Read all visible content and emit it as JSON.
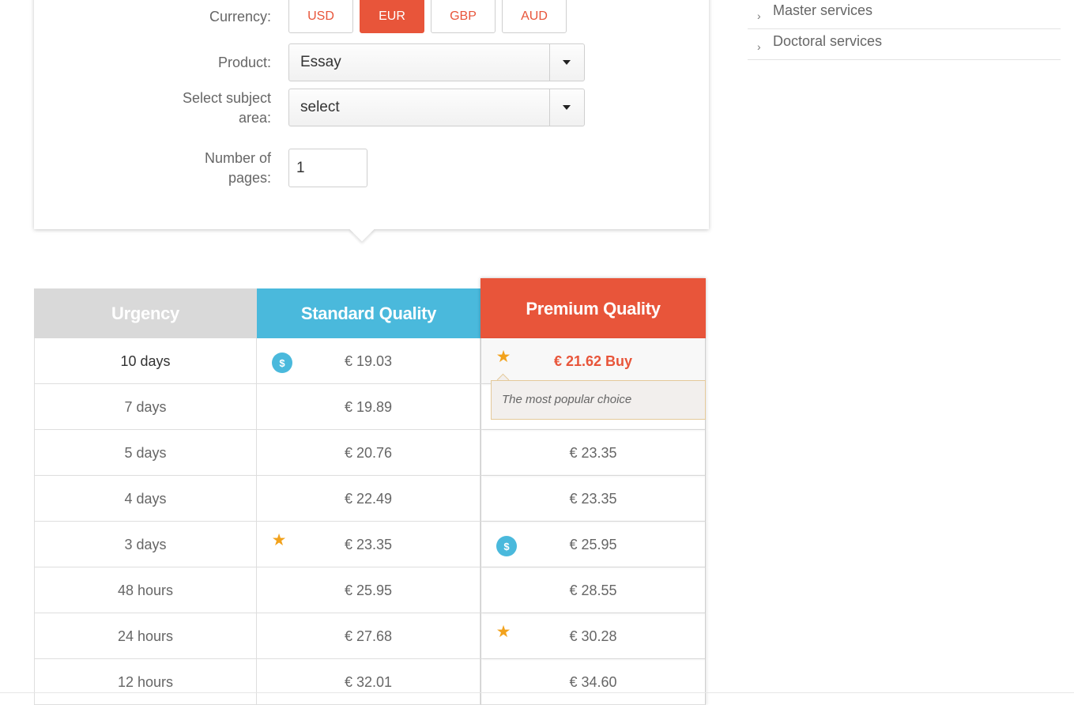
{
  "calculator": {
    "currency_label": "Currency:",
    "currencies": [
      {
        "code": "USD",
        "active": false
      },
      {
        "code": "EUR",
        "active": true
      },
      {
        "code": "GBP",
        "active": false
      },
      {
        "code": "AUD",
        "active": false
      }
    ],
    "product_label": "Product:",
    "product_value": "Essay",
    "subject_label_line1": "Select subject",
    "subject_label_line2": "area:",
    "subject_value": "select",
    "pages_label_line1": "Number of",
    "pages_label_line2": "pages:",
    "pages_value": "1"
  },
  "sidebar": {
    "items": [
      {
        "label": "Master services"
      },
      {
        "label": "Doctoral services"
      }
    ]
  },
  "price_table": {
    "headers": {
      "urgency": "Urgency",
      "standard": "Standard Quality",
      "premium": "Premium Quality"
    },
    "rows": [
      {
        "urgency": "10 days",
        "standard": "€ 19.03",
        "premium": "€ 21.62 Buy"
      },
      {
        "urgency": "7 days",
        "standard": "€ 19.89",
        "premium": ""
      },
      {
        "urgency": "5 days",
        "standard": "€ 20.76",
        "premium": "€ 23.35"
      },
      {
        "urgency": "4 days",
        "standard": "€ 22.49",
        "premium": "€ 23.35"
      },
      {
        "urgency": "3 days",
        "standard": "€ 23.35",
        "premium": "€ 25.95"
      },
      {
        "urgency": "48 hours",
        "standard": "€ 25.95",
        "premium": "€ 28.55"
      },
      {
        "urgency": "24 hours",
        "standard": "€ 27.68",
        "premium": "€ 30.28"
      },
      {
        "urgency": "12 hours",
        "standard": "€ 32.01",
        "premium": "€ 34.60"
      }
    ],
    "popular_tip": "The most popular choice",
    "icons": {
      "coin_symbol": "$",
      "star_symbol": "★"
    },
    "colors": {
      "accent": "#e8553a",
      "standard": "#4ab9dc",
      "urgency": "#d9d9d9",
      "star": "#f2a21c"
    }
  }
}
